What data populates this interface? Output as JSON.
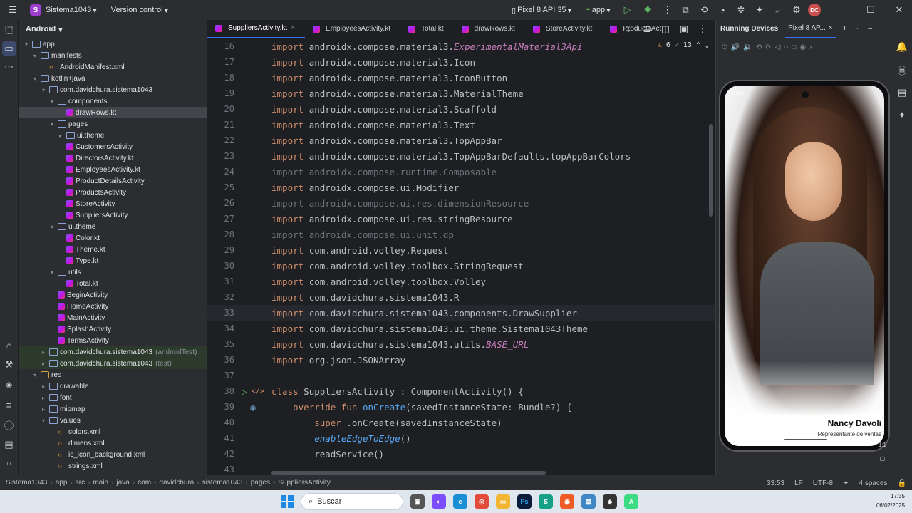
{
  "titlebar": {
    "project_badge": "S",
    "project_name": "Sistema1043",
    "vcs": "Version control",
    "device": "Pixel 8 API 35",
    "run_config": "app",
    "avatar": "DC"
  },
  "project_panel": {
    "title": "Android",
    "tree": [
      {
        "label": "app",
        "indent": 0,
        "arrow": "▾",
        "icon": "folder"
      },
      {
        "label": "manifests",
        "indent": 1,
        "arrow": "▾",
        "icon": "folder"
      },
      {
        "label": "AndroidManifest.xml",
        "indent": 2,
        "arrow": "",
        "icon": "xml"
      },
      {
        "label": "kotlin+java",
        "indent": 1,
        "arrow": "▾",
        "icon": "folder"
      },
      {
        "label": "com.davidchura.sistema1043",
        "indent": 2,
        "arrow": "▾",
        "icon": "folder"
      },
      {
        "label": "components",
        "indent": 3,
        "arrow": "▾",
        "icon": "folder"
      },
      {
        "label": "drawRows.kt",
        "indent": 4,
        "arrow": "",
        "icon": "kt",
        "selected": true
      },
      {
        "label": "pages",
        "indent": 3,
        "arrow": "▾",
        "icon": "folder"
      },
      {
        "label": "ui.theme",
        "indent": 4,
        "arrow": "▸",
        "icon": "folder"
      },
      {
        "label": "CustomersActivity",
        "indent": 4,
        "arrow": "",
        "icon": "kt"
      },
      {
        "label": "DirectorsActivity.kt",
        "indent": 4,
        "arrow": "",
        "icon": "kt"
      },
      {
        "label": "EmployeesActivity.kt",
        "indent": 4,
        "arrow": "",
        "icon": "kt"
      },
      {
        "label": "ProductDetailsActivity",
        "indent": 4,
        "arrow": "",
        "icon": "kt"
      },
      {
        "label": "ProductsActivity",
        "indent": 4,
        "arrow": "",
        "icon": "kt"
      },
      {
        "label": "StoreActivity",
        "indent": 4,
        "arrow": "",
        "icon": "kt"
      },
      {
        "label": "SuppliersActivity",
        "indent": 4,
        "arrow": "",
        "icon": "kt"
      },
      {
        "label": "ui.theme",
        "indent": 3,
        "arrow": "▾",
        "icon": "folder"
      },
      {
        "label": "Color.kt",
        "indent": 4,
        "arrow": "",
        "icon": "kt"
      },
      {
        "label": "Theme.kt",
        "indent": 4,
        "arrow": "",
        "icon": "kt"
      },
      {
        "label": "Type.kt",
        "indent": 4,
        "arrow": "",
        "icon": "kt"
      },
      {
        "label": "utils",
        "indent": 3,
        "arrow": "▾",
        "icon": "folder"
      },
      {
        "label": "Total.kt",
        "indent": 4,
        "arrow": "",
        "icon": "kt"
      },
      {
        "label": "BeginActivity",
        "indent": 3,
        "arrow": "",
        "icon": "kt"
      },
      {
        "label": "HomeActivity",
        "indent": 3,
        "arrow": "",
        "icon": "kt"
      },
      {
        "label": "MainActivity",
        "indent": 3,
        "arrow": "",
        "icon": "kt"
      },
      {
        "label": "SplashActivity",
        "indent": 3,
        "arrow": "",
        "icon": "kt"
      },
      {
        "label": "TermsActivity",
        "indent": 3,
        "arrow": "",
        "icon": "kt"
      },
      {
        "label": "com.davidchura.sistema1043",
        "suffix": "(androidTest)",
        "indent": 2,
        "arrow": "▸",
        "icon": "folder",
        "green": true
      },
      {
        "label": "com.davidchura.sistema1043",
        "suffix": "(test)",
        "indent": 2,
        "arrow": "▸",
        "icon": "folder",
        "green": true
      },
      {
        "label": "res",
        "indent": 1,
        "arrow": "▾",
        "icon": "res"
      },
      {
        "label": "drawable",
        "indent": 2,
        "arrow": "▸",
        "icon": "folder"
      },
      {
        "label": "font",
        "indent": 2,
        "arrow": "▸",
        "icon": "folder"
      },
      {
        "label": "mipmap",
        "indent": 2,
        "arrow": "▸",
        "icon": "folder"
      },
      {
        "label": "values",
        "indent": 2,
        "arrow": "▾",
        "icon": "folder"
      },
      {
        "label": "colors.xml",
        "indent": 3,
        "arrow": "",
        "icon": "xml"
      },
      {
        "label": "dimens.xml",
        "indent": 3,
        "arrow": "",
        "icon": "xml"
      },
      {
        "label": "ic_icon_background.xml",
        "indent": 3,
        "arrow": "",
        "icon": "xml"
      },
      {
        "label": "strings.xml",
        "indent": 3,
        "arrow": "",
        "icon": "xml"
      }
    ]
  },
  "editor": {
    "tabs": [
      {
        "label": "SuppliersActivity.kt",
        "active": true,
        "close": "×"
      },
      {
        "label": "EmployeesActivity.kt"
      },
      {
        "label": "Total.kt"
      },
      {
        "label": "drawRows.kt"
      },
      {
        "label": "StoreActivity.kt"
      },
      {
        "label": "ProductsAct"
      }
    ],
    "inspections": {
      "warnings": "6",
      "weak_warnings": "13"
    },
    "lines": [
      {
        "n": "16",
        "kw": "import",
        "text": "androidx.compose.material3.",
        "hl": "ExperimentalMaterial3Api",
        "hl_class": "it"
      },
      {
        "n": "17",
        "kw": "import",
        "text": "androidx.compose.material3.Icon"
      },
      {
        "n": "18",
        "kw": "import",
        "text": "androidx.compose.material3.IconButton"
      },
      {
        "n": "19",
        "kw": "import",
        "text": "androidx.compose.material3.MaterialTheme"
      },
      {
        "n": "20",
        "kw": "import",
        "text": "androidx.compose.material3.Scaffold"
      },
      {
        "n": "21",
        "kw": "import",
        "text": "androidx.compose.material3.Text"
      },
      {
        "n": "22",
        "kw": "import",
        "text": "androidx.compose.material3.TopAppBar"
      },
      {
        "n": "23",
        "kw": "import",
        "text": "androidx.compose.material3.TopAppBarDefaults.topAppBarColors"
      },
      {
        "n": "24",
        "kw": "import",
        "text": "androidx.compose.runtime.Composable",
        "dim": true
      },
      {
        "n": "25",
        "kw": "import",
        "text": "androidx.compose.ui.Modifier"
      },
      {
        "n": "26",
        "kw": "import",
        "text": "androidx.compose.ui.res.dimensionResource",
        "dim": true
      },
      {
        "n": "27",
        "kw": "import",
        "text": "androidx.compose.ui.res.stringResource"
      },
      {
        "n": "28",
        "kw": "import",
        "text": "androidx.compose.ui.unit.dp",
        "dim": true
      },
      {
        "n": "29",
        "kw": "import",
        "text": "com.android.volley.Request"
      },
      {
        "n": "30",
        "kw": "import",
        "text": "com.android.volley.toolbox.StringRequest"
      },
      {
        "n": "31",
        "kw": "import",
        "text": "com.android.volley.toolbox.Volley"
      },
      {
        "n": "32",
        "kw": "import",
        "text": "com.davidchura.sistema1043.R"
      },
      {
        "n": "33",
        "kw": "import",
        "text": "com.davidchura.sistema1043.components.DrawSupplier",
        "current": true
      },
      {
        "n": "34",
        "kw": "import",
        "text": "com.davidchura.sistema1043.ui.theme.Sistema1043Theme"
      },
      {
        "n": "35",
        "kw": "import",
        "text": "com.davidchura.sistema1043.utils.",
        "hl": "BASE_URL",
        "hl_class": "it"
      },
      {
        "n": "36",
        "kw": "import",
        "text": "org.json.JSONArray"
      },
      {
        "n": "37",
        "kw": "",
        "text": ""
      },
      {
        "n": "38",
        "kw": "class",
        "text": "SuppliersActivity : ComponentActivity() {",
        "gutter": "run"
      },
      {
        "n": "39",
        "kw": "    override fun",
        "text": "",
        "hl": "onCreate",
        "hl_class": "fn",
        "tail": "(savedInstanceState: Bundle?) {",
        "gutter": "override"
      },
      {
        "n": "40",
        "kw": "        super",
        "text": ".onCreate(savedInstanceState)"
      },
      {
        "n": "41",
        "kw": "",
        "text": "        ",
        "hl": "enableEdgeToEdge",
        "hl_class": "italic-fn",
        "tail": "()"
      },
      {
        "n": "42",
        "kw": "",
        "text": "        readService()"
      },
      {
        "n": "43",
        "kw": "",
        "text": ""
      }
    ]
  },
  "running_devices": {
    "title": "Running Devices",
    "device_tab": "Pixel 8 AP...",
    "status_time": "10:33",
    "person_name": "Nancy Davoli",
    "person_role": "Representante de ventas",
    "zoom": "1:1"
  },
  "statusbar": {
    "crumbs": [
      "Sistema1043",
      "app",
      "src",
      "main",
      "java",
      "com",
      "davidchura",
      "sistema1043",
      "pages",
      "SuppliersActivity"
    ],
    "position": "33:53",
    "line_sep": "LF",
    "encoding": "UTF-8",
    "indent": "4 spaces"
  },
  "taskbar": {
    "search_placeholder": "Buscar",
    "time": "17:35",
    "date": "06/02/2025"
  }
}
